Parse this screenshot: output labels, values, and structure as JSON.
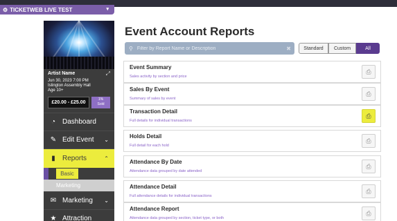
{
  "venue_selector": {
    "label": "TICKETWEB LIVE TEST",
    "icon": "gear-icon",
    "caret": "▾"
  },
  "event": {
    "artist": "Artist Name",
    "date": "Jun 30, 2023 7:00 PM",
    "venue": "Islington Assembly Hall",
    "age": "Age 10+",
    "price": "£20.00 - £25.00",
    "sold_pct": "1%",
    "sold_label": "Sold"
  },
  "nav": {
    "dashboard": "Dashboard",
    "edit_event": "Edit Event",
    "reports": "Reports",
    "reports_sub": {
      "basic": "Basic",
      "marketing": "Marketing"
    },
    "marketing": "Marketing",
    "attraction": "Attraction"
  },
  "colors": {
    "accent_purple": "#5a3b8f",
    "highlight_yellow": "#ecec3d",
    "sidebar_bg": "#3c3c3c"
  },
  "page": {
    "title": "Event Account Reports",
    "search_placeholder": "Filter by Report Name or Description",
    "filters": {
      "standard": "Standard",
      "custom": "Custom",
      "all": "All",
      "active": "All"
    }
  },
  "reports": [
    {
      "name": "Event Summary",
      "desc": "Sales activity by section and price",
      "highlighted": false
    },
    {
      "name": "Sales By Event",
      "desc": "Summary of sales by event",
      "highlighted": false
    },
    {
      "name": "Transaction Detail",
      "desc": "Full details for individual transactions",
      "highlighted": true
    },
    {
      "name": "Holds Detail",
      "desc": "Full detail for each hold",
      "highlighted": false
    },
    {
      "name": "Attendance By Date",
      "desc": "Attendance data grouped by date attended",
      "highlighted": false
    },
    {
      "name": "Attendance Detail",
      "desc": "Full attendance details for individual transactions",
      "highlighted": false
    },
    {
      "name": "Attendance Report",
      "desc": "Attendance data grouped by section, ticket type, or both",
      "highlighted": false
    }
  ]
}
